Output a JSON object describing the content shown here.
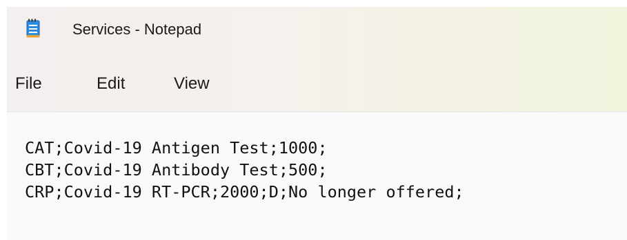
{
  "window": {
    "title": "Services - Notepad",
    "app_icon": "notepad-icon"
  },
  "menu": {
    "file": "File",
    "edit": "Edit",
    "view": "View"
  },
  "editor": {
    "lines": [
      "CAT;Covid-19 Antigen Test;1000;",
      "CBT;Covid-19 Antibody Test;500;",
      "CRP;Covid-19 RT-PCR;2000;D;No longer offered;"
    ]
  },
  "colors": {
    "icon_blue": "#1f7fd8",
    "icon_accent": "#5a8fd6"
  }
}
